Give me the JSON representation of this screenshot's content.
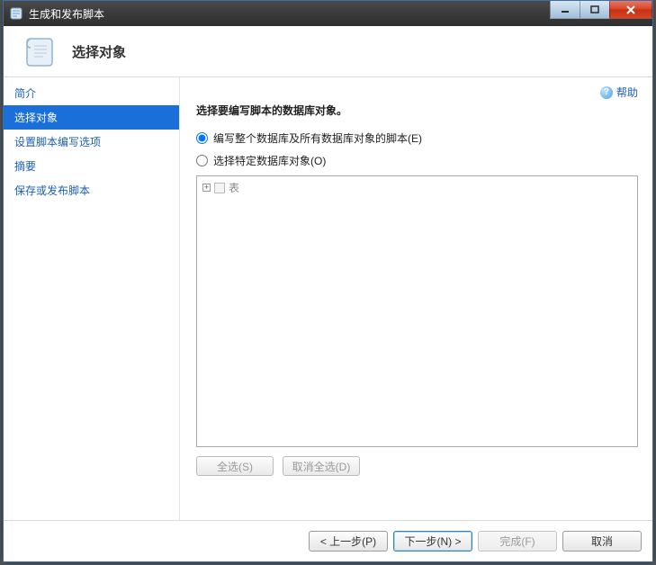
{
  "window": {
    "title": "生成和发布脚本"
  },
  "header": {
    "page_title": "选择对象"
  },
  "sidebar": {
    "items": [
      {
        "label": "简介"
      },
      {
        "label": "选择对象"
      },
      {
        "label": "设置脚本编写选项"
      },
      {
        "label": "摘要"
      },
      {
        "label": "保存或发布脚本"
      }
    ],
    "selected_index": 1
  },
  "help": {
    "label": "帮助"
  },
  "content": {
    "prompt": "选择要编写脚本的数据库对象。",
    "option_all": "编写整个数据库及所有数据库对象的脚本(E)",
    "option_specific": "选择特定数据库对象(O)",
    "selected_option": "all",
    "tree_root": "表",
    "select_all": "全选(S)",
    "deselect_all": "取消全选(D)"
  },
  "footer": {
    "back": "< 上一步(P)",
    "next_label": "下一步(N) >",
    "finish": "完成(F)",
    "cancel": "取消"
  }
}
